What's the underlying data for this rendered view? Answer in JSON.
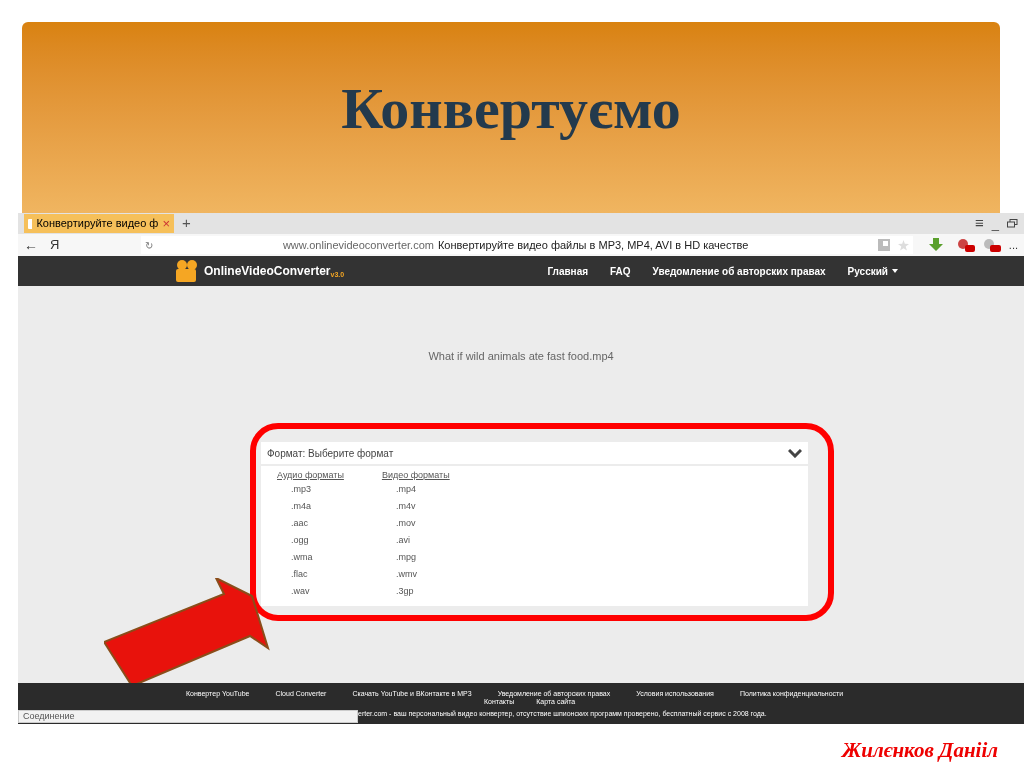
{
  "slide": {
    "title": "Конвертуємо",
    "author": "Жилєнков Данііл"
  },
  "browser": {
    "tab": {
      "title": "Конвертируйте видео ф",
      "close": "×"
    },
    "new_tab": "+",
    "back": "←",
    "yandex": "Я",
    "reload": "↻",
    "url_domain": "www.onlinevideoconverter.com",
    "page_title": "Конвертируйте видео файлы в MP3, MP4, AVI в HD качестве",
    "menu": "≡",
    "minimize": "_",
    "more": "...",
    "status": "Соединение"
  },
  "site": {
    "logo": "OnlineVideoConverter",
    "version": "v3.0",
    "nav": [
      {
        "label": "Главная",
        "dropdown": false
      },
      {
        "label": "FAQ",
        "dropdown": false
      },
      {
        "label": "Уведомление об авторских правах",
        "dropdown": false
      },
      {
        "label": "Русский",
        "dropdown": true
      }
    ],
    "file_name": "What if wild animals ate fast food.mp4",
    "format_select": {
      "label": "Формат: Выберите формат",
      "expanded": true
    },
    "groups": [
      {
        "heading": "Аудио форматы",
        "items": [
          ".mp3",
          ".m4a",
          ".aac",
          ".ogg",
          ".wma",
          ".flac",
          ".wav"
        ]
      },
      {
        "heading": "Видео форматы",
        "items": [
          ".mp4",
          ".m4v",
          ".mov",
          ".avi",
          ".mpg",
          ".wmv",
          ".3gp"
        ]
      }
    ],
    "footer_links": [
      "Конвертер YouTube",
      "Cloud Converter",
      "Скачать YouTube и ВКонтакте в MP3",
      "Уведомление об авторских правах",
      "Условия использования",
      "Политика конфиденциальности"
    ],
    "footer_links_2": [
      "Контакты",
      "Карта сайта"
    ],
    "footer_text": "erter.com - ваш персональный видео конвертер, отсутствие шпионских программ проверено, бесплатный сервис с 2008 года."
  }
}
